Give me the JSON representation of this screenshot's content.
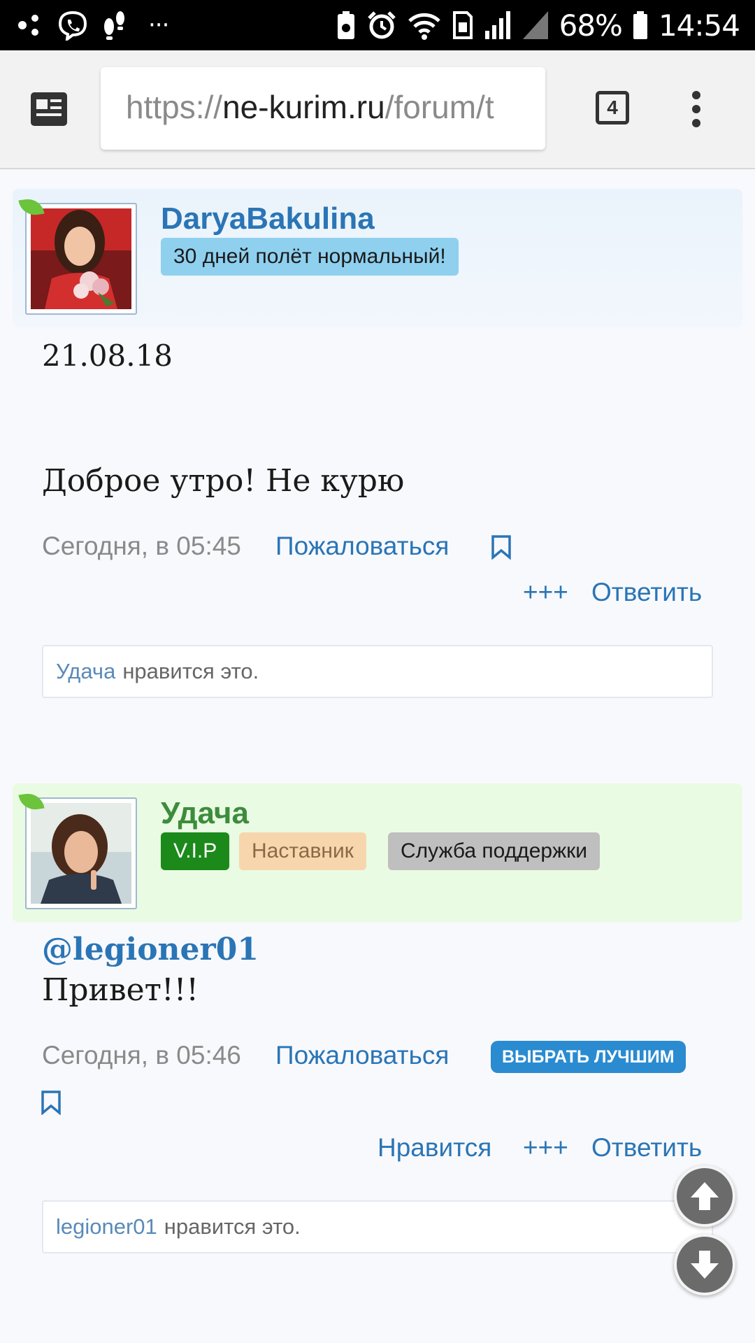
{
  "status_bar": {
    "battery": "68%",
    "time": "14:54",
    "notifications_more": "···"
  },
  "browser": {
    "url_scheme": "https://",
    "url_host": "ne-kurim.ru",
    "url_path": "/forum/t",
    "tab_count": "4"
  },
  "posts": [
    {
      "username": "DaryaBakulina",
      "username_color": "#2a75b5",
      "title_badge": "30 дней полёт нормальный!",
      "body_lines": [
        "21.08.18",
        "Доброе утро! Не курю"
      ],
      "timestamp": "Сегодня, в 05:45",
      "report_label": "Пожаловаться",
      "plus_label": "+++",
      "reply_label": "Ответить",
      "likes": {
        "user": "Удача",
        "text": "нравится это."
      }
    },
    {
      "username": "Удача",
      "username_color": "#3d8c3d",
      "badges": [
        "V.I.P",
        "Наставник",
        "Служба поддержки"
      ],
      "mention": "@legioner01",
      "body": "Привет!!!",
      "timestamp": "Сегодня, в 05:46",
      "report_label": "Пожаловаться",
      "best_label": "ВЫБРАТЬ ЛУЧШИМ",
      "like_label": "Нравится",
      "plus_label": "+++",
      "reply_label": "Ответить",
      "likes": {
        "user": "legioner01",
        "text": "нравится это."
      }
    }
  ]
}
